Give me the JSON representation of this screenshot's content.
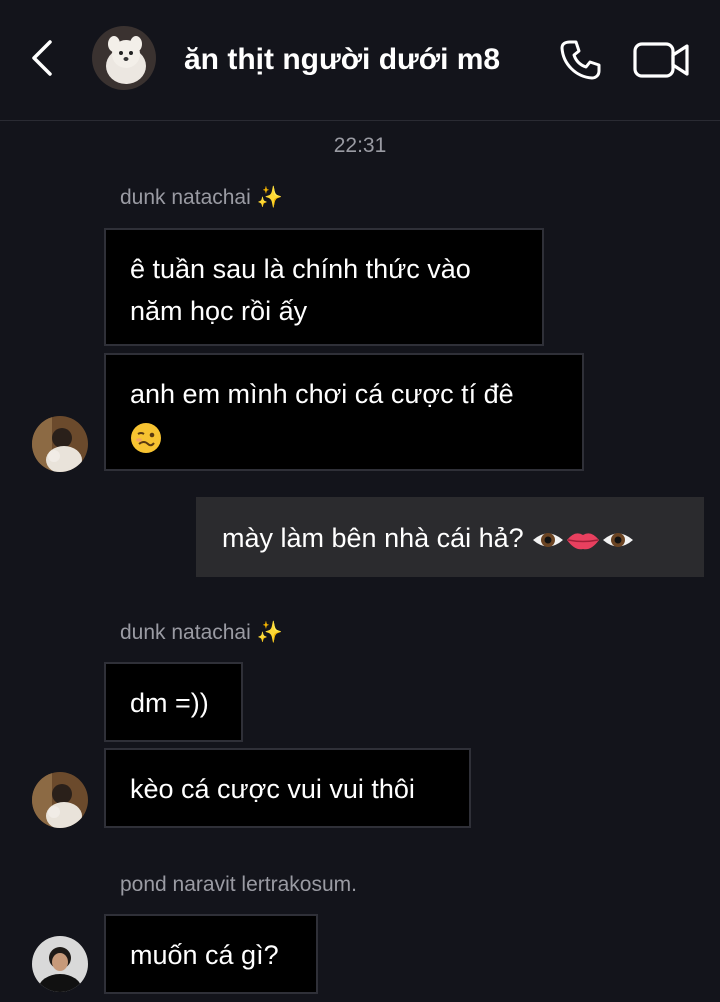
{
  "header": {
    "title": "ăn thịt người dưới m8"
  },
  "conversation": {
    "timestamp": "22:31",
    "messages": [
      {
        "sender": "dunk natachai ✨",
        "text": "ê tuần sau là chính thức vào năm học rồi ấy"
      },
      {
        "text": "anh em mình chơi cá cược tí đê"
      },
      {
        "direction": "outgoing",
        "text": "mày làm bên nhà cái hả?"
      },
      {
        "sender": "dunk natachai ✨",
        "text": "dm =))"
      },
      {
        "text": "kèo cá cược vui vui thôi"
      },
      {
        "sender": "pond naravit lertrakosum.",
        "text": "muốn cá gì?"
      }
    ]
  },
  "icons": {
    "back": "chevron-left-icon",
    "call": "phone-icon",
    "video": "video-camera-icon",
    "emoji_woozy": "woozy-face-icon",
    "emoji_eye": "eye-icon",
    "emoji_lips": "lips-icon",
    "sparkles": "sparkles-icon"
  },
  "colors": {
    "background": "#13141b",
    "incoming_bubble": "#000000",
    "outgoing_bubble": "#2b2b2e",
    "secondary_text": "#9a9ba3"
  }
}
